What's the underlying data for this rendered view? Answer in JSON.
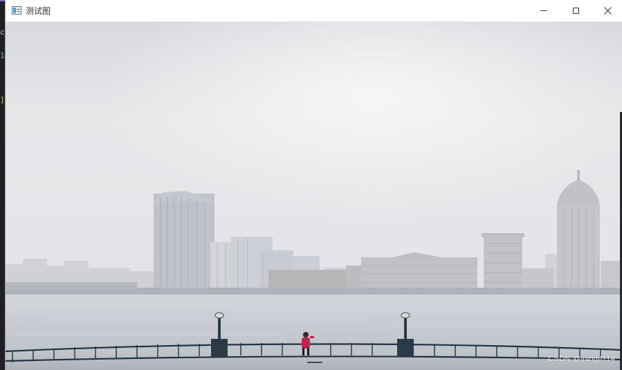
{
  "window": {
    "title": "测试图"
  },
  "photo": {
    "watermark": "CSDN @yangjf114"
  },
  "colors": {
    "sky_top": "#d9dadf",
    "sky_glow": "#f4f4f5",
    "water": "#c9cdd3",
    "railing": "#1f3243",
    "person_coat": "#c2234a"
  },
  "icons": {
    "app": "window-app-icon",
    "minimize": "minimize-icon",
    "maximize": "maximize-icon",
    "close": "close-icon"
  }
}
